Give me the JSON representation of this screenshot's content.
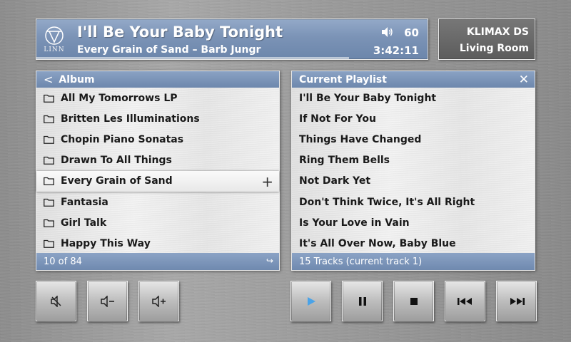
{
  "now_playing": {
    "logo_text": "LINN",
    "title": "I'll Be Your Baby Tonight",
    "subtitle": "Every Grain of Sand – Barb Jungr",
    "volume": "60",
    "time": "3:42:11",
    "progress_fraction": 0.8
  },
  "device": {
    "name": "KLIMAX DS",
    "room": "Living Room"
  },
  "album_panel": {
    "title": "Album",
    "items": [
      "All My Tomorrows LP",
      "Britten Les Illuminations",
      "Chopin Piano Sonatas",
      "Drawn To All Things",
      "Every Grain of Sand",
      "Fantasia",
      "Girl Talk",
      "Happy This Way"
    ],
    "selected_index": 4,
    "footer": "10 of 84"
  },
  "playlist_panel": {
    "title": "Current Playlist",
    "items": [
      "I'll Be Your Baby Tonight",
      "If Not For You",
      "Things Have Changed",
      "Ring Them Bells",
      "Not Dark Yet",
      "Don't Think Twice, It's All Right",
      "Is Your Love in Vain",
      "It's All Over Now, Baby Blue"
    ],
    "footer": "15 Tracks (current track 1)"
  },
  "icons": {
    "mute": "mute-icon",
    "volume_down": "volume-down-icon",
    "volume_up": "volume-up-icon",
    "play": "play-icon",
    "pause": "pause-icon",
    "stop": "stop-icon",
    "previous": "previous-icon",
    "next": "next-icon"
  },
  "colors": {
    "accent_blue": "#7b93b6",
    "play_active": "#4aa3e8"
  }
}
